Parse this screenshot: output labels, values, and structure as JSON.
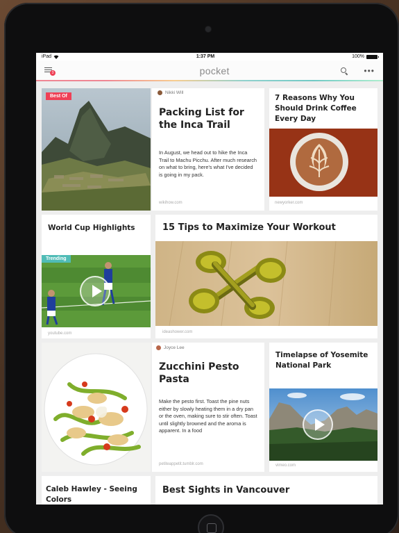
{
  "status_bar": {
    "carrier": "iPad",
    "time": "1:37 PM",
    "battery": "100%"
  },
  "header": {
    "menu_badge": "3",
    "logo": "pocket"
  },
  "cards": {
    "machu": {
      "badge": "Best Of"
    },
    "packing": {
      "author": "Nikki Will",
      "title": "Packing List for the Inca Trail",
      "excerpt": "In August, we head out to hike the Inca Trail to Machu Picchu. After much research on what to bring, here's what I've decided is going in my pack.",
      "source": "wikihow.com"
    },
    "coffee": {
      "title": "7 Reasons Why You Should Drink Coffee Every Day",
      "source": "newyorker.com"
    },
    "worldcup": {
      "title": "World Cup Highlights",
      "badge": "Trending",
      "source": "youtube.com"
    },
    "workout": {
      "title": "15 Tips to Maximize Your Workout",
      "source": "ideashower.com"
    },
    "salad": {},
    "zucchini": {
      "author": "Joyce Lee",
      "title": "Zucchini Pesto Pasta",
      "excerpt": "Make the pesto first. Toast the pine nuts either by slowly heating them in a dry pan or the oven, making sure to stir often. Toast until slightly browned and the aroma is apparent. In a food",
      "source": "petiteappetit.tumblr.com"
    },
    "yosemite": {
      "title": "Timelapse of Yosemite National Park",
      "source": "vimeo.com"
    },
    "caleb": {
      "title": "Caleb Hawley - Seeing Colors"
    },
    "vancouver": {
      "title": "Best Sights in Vancouver"
    }
  }
}
